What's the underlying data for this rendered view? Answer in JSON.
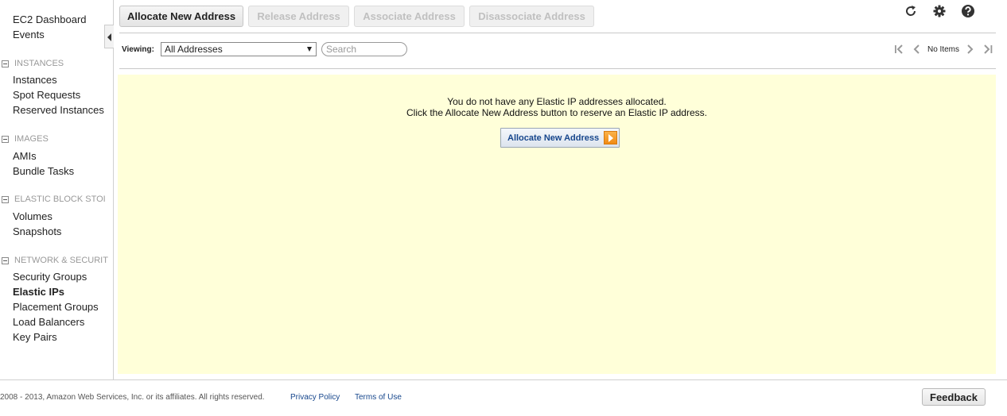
{
  "sidebar": {
    "top_items": [
      {
        "label": "EC2 Dashboard"
      },
      {
        "label": "Events"
      }
    ],
    "sections": [
      {
        "title": "INSTANCES",
        "items": [
          "Instances",
          "Spot Requests",
          "Reserved Instances"
        ]
      },
      {
        "title": "IMAGES",
        "items": [
          "AMIs",
          "Bundle Tasks"
        ]
      },
      {
        "title": "ELASTIC BLOCK STOI",
        "items": [
          "Volumes",
          "Snapshots"
        ]
      },
      {
        "title": "NETWORK & SECURIT",
        "items": [
          "Security Groups",
          "Elastic IPs",
          "Placement Groups",
          "Load Balancers",
          "Key Pairs"
        ]
      }
    ],
    "active_item": "Elastic IPs"
  },
  "toolbar": {
    "allocate_label": "Allocate New Address",
    "release_label": "Release Address",
    "associate_label": "Associate Address",
    "disassociate_label": "Disassociate Address",
    "icons": [
      "refresh-icon",
      "gear-icon",
      "help-icon"
    ]
  },
  "filter": {
    "viewing_label": "Viewing:",
    "selected": "All Addresses",
    "search_placeholder": "Search"
  },
  "pager": {
    "status": "No Items"
  },
  "main": {
    "message_line1": "You do not have any Elastic IP addresses allocated.",
    "message_line2": "Click the Allocate New Address button to reserve an Elastic IP address.",
    "button_label": "Allocate New Address"
  },
  "footer": {
    "copyright": "2008 - 2013, Amazon Web Services, Inc. or its affiliates. All rights reserved.",
    "privacy": "Privacy Policy",
    "terms": "Terms of Use",
    "feedback": "Feedback"
  },
  "colors": {
    "panel_bg": "#ffffd9",
    "link_blue": "#16468c",
    "accent_orange": "#f08a13"
  }
}
